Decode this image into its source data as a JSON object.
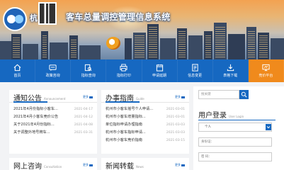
{
  "header": {
    "logo_text": "杭",
    "system_title": "客车总量调控管理信息系统"
  },
  "nav": {
    "items": [
      {
        "label": "首页",
        "icon": "home-icon"
      },
      {
        "label": "政策咨询",
        "icon": "policy-icon"
      },
      {
        "label": "指标查询",
        "icon": "query-icon"
      },
      {
        "label": "指标打印",
        "icon": "print-icon"
      },
      {
        "label": "申请延期",
        "icon": "extend-icon"
      },
      {
        "label": "信息变更",
        "icon": "change-icon"
      },
      {
        "label": "表格下载",
        "icon": "download-icon"
      },
      {
        "label": "竞价平台",
        "icon": "bidding-icon",
        "active": true
      }
    ],
    "active_color": "#f08a1c",
    "bar_color": "#1668c1"
  },
  "notice": {
    "title": "通知公告",
    "subtitle": "Announcement",
    "more": "更多",
    "items": [
      {
        "text": "2021年4月份指标小客车...",
        "date": "2021-04-17"
      },
      {
        "text": "2021年4月小客车竞价公告",
        "date": "2021-04-12"
      },
      {
        "text": "关于2021年4月份指标...",
        "date": "2021-04-08"
      },
      {
        "text": "关于调整外地号牌车...",
        "date": "2021-03-31"
      }
    ]
  },
  "guide": {
    "title": "办事指南",
    "subtitle": "Guide",
    "more": "更多",
    "items": [
      {
        "text": "杭州市小客车摇号个人申请...",
        "date": "2021-03-01"
      },
      {
        "text": "杭州市小客车增量指标...",
        "date": "2021-03-01"
      },
      {
        "text": "单位指标申请办理指南",
        "date": "2021-03-03"
      },
      {
        "text": "杭州市小客车指标申请...",
        "date": "2021-03-03"
      },
      {
        "text": "杭州市小客车竞价指南",
        "date": "2021-03-15"
      }
    ]
  },
  "consult": {
    "title": "网上咨询",
    "subtitle": "Consultation",
    "more": "更多"
  },
  "news": {
    "title": "新闻转载",
    "subtitle": "News",
    "more": "更多"
  },
  "sidebar": {
    "search_placeholder": "搜关键",
    "login_title": "用户登录",
    "login_subtitle": "User Login",
    "user_type": "个人",
    "id_label": "身份证：",
    "password_label": "密 码："
  }
}
